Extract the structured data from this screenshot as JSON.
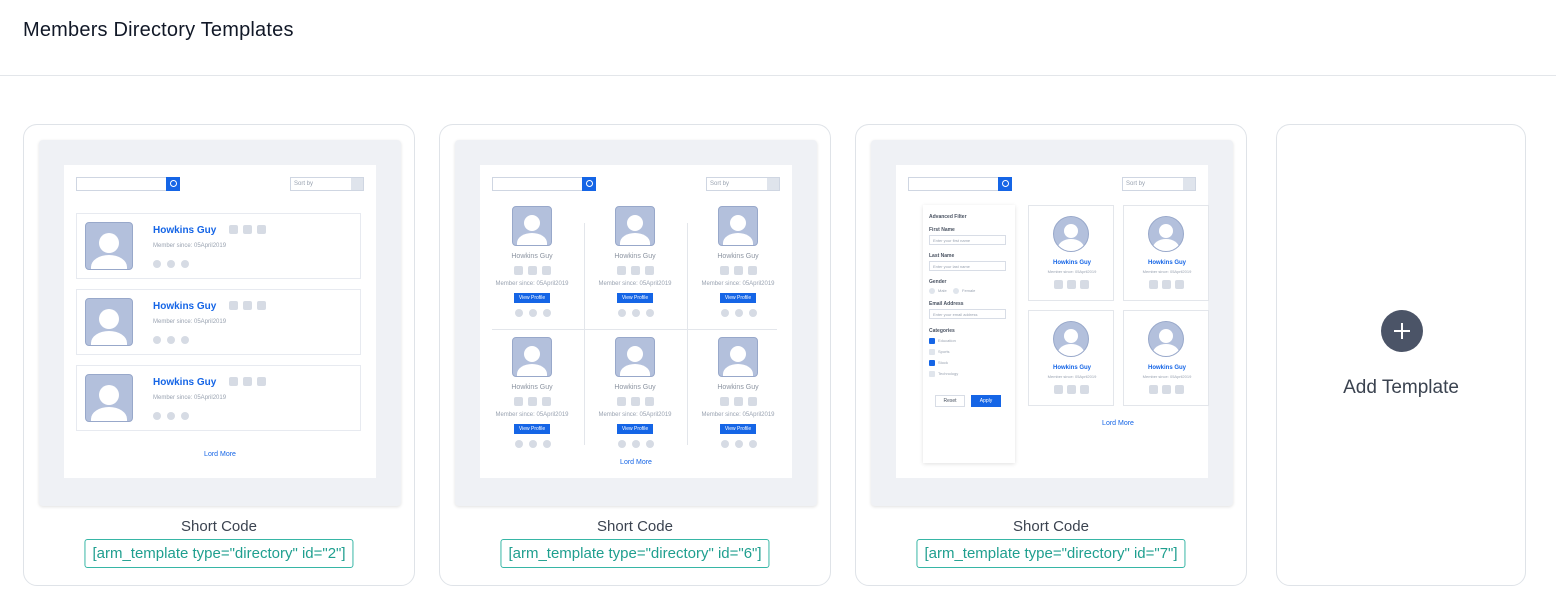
{
  "header": {
    "title": "Members Directory Templates"
  },
  "templates": [
    {
      "short_code_label": "Short Code",
      "short_code": "[arm_template type=\"directory\" id=\"2\"]"
    },
    {
      "short_code_label": "Short Code",
      "short_code": "[arm_template type=\"directory\" id=\"6\"]"
    },
    {
      "short_code_label": "Short Code",
      "short_code": "[arm_template type=\"directory\" id=\"7\"]"
    }
  ],
  "add_template": {
    "label": "Add Template",
    "icon": "plus-icon"
  },
  "preview": {
    "member_name": "Howkins Guy",
    "member_since": "Member since: 05April2019",
    "sort_placeholder": "Sort by",
    "view_profile": "View Profile",
    "load_more": "Lord More",
    "filter": {
      "title": "Advanced Filter",
      "first_name": "First Name",
      "first_name_placeholder": "Enter your first name",
      "last_name": "Last Name",
      "last_name_placeholder": "Enter your last name",
      "gender": "Gender",
      "male": "Male",
      "female": "Female",
      "email": "Email Address",
      "email_placeholder": "Enter your email address",
      "categories": "Categories",
      "cat1": "Education",
      "cat2": "Sports",
      "cat3": "Stock",
      "cat4": "Technology",
      "reset": "Reset",
      "apply": "Apply"
    }
  }
}
